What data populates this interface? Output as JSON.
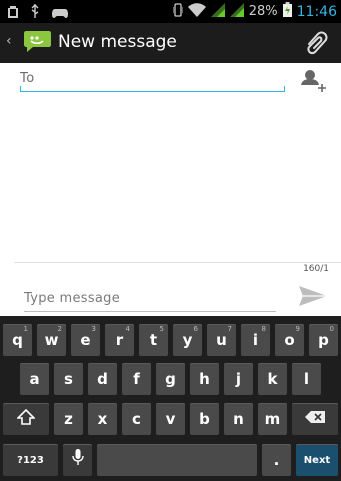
{
  "status_bar": {
    "battery_text": "28%",
    "time": "11:46"
  },
  "action_bar": {
    "title": "New message"
  },
  "to_field": {
    "placeholder": "To"
  },
  "compose": {
    "char_count": "160/1",
    "placeholder": "Type message"
  },
  "keyboard": {
    "row1": [
      {
        "label": "q",
        "hint": "1"
      },
      {
        "label": "w",
        "hint": "2"
      },
      {
        "label": "e",
        "hint": "3"
      },
      {
        "label": "r",
        "hint": "4"
      },
      {
        "label": "t",
        "hint": "5"
      },
      {
        "label": "y",
        "hint": "6"
      },
      {
        "label": "u",
        "hint": "7"
      },
      {
        "label": "i",
        "hint": "8"
      },
      {
        "label": "o",
        "hint": "9"
      },
      {
        "label": "p",
        "hint": "0"
      }
    ],
    "row2": [
      "a",
      "s",
      "d",
      "f",
      "g",
      "h",
      "j",
      "k",
      "l"
    ],
    "row3": [
      "z",
      "x",
      "c",
      "v",
      "b",
      "n",
      "m"
    ],
    "symbols_label": "?123",
    "period_label": ".",
    "next_label": "Next"
  },
  "colors": {
    "accent": "#33b5e5",
    "keyboard_bg": "#1e1e1e",
    "key_bg": "#4a4a4a",
    "next_key_bg": "#1a4f6e"
  }
}
